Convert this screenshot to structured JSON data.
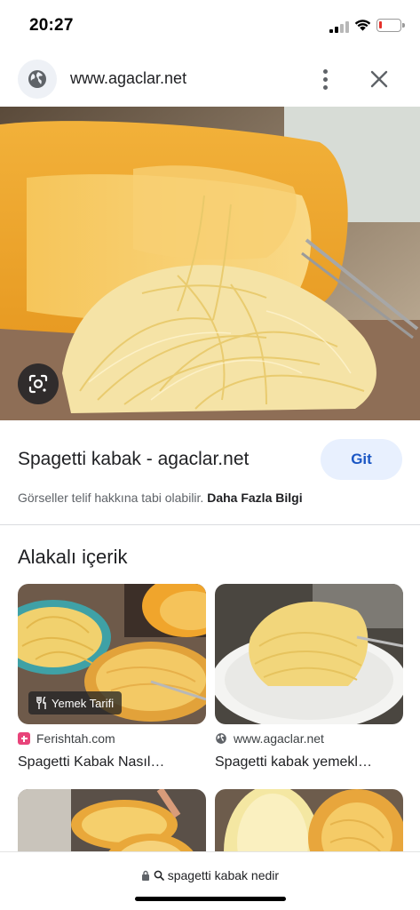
{
  "status_bar": {
    "time": "20:27",
    "battery_level": 0.12,
    "battery_color": "#e5312b"
  },
  "url_bar": {
    "url": "www.agaclar.net",
    "icons": [
      "globe-icon",
      "more-vert-icon",
      "close-icon"
    ]
  },
  "hero": {
    "icon": "lens-icon"
  },
  "result": {
    "title": "Spagetti kabak - agaclar.net",
    "go_button": "Git",
    "copyright_text": "Görseller telif hakkına tabi olabilir.",
    "more_info": "Daha Fazla Bilgi"
  },
  "related": {
    "heading": "Alakalı içerik",
    "cards": [
      {
        "badge": "Yemek Tarifi",
        "source": "Ferishtah.com",
        "title": "Spagetti Kabak Nasıl…",
        "favicon": "ferishtah-favicon"
      },
      {
        "source": "www.agaclar.net",
        "title": "Spagetti kabak yemekl…",
        "favicon": "globe-icon"
      }
    ]
  },
  "bottom_bar": {
    "query": "spagetti kabak nedir",
    "icons": [
      "lock-icon",
      "search-icon"
    ]
  },
  "colors": {
    "accent_blue": "#1a56c4",
    "button_bg": "#e8f0fe",
    "ferishtah_pink": "#e8447a"
  }
}
